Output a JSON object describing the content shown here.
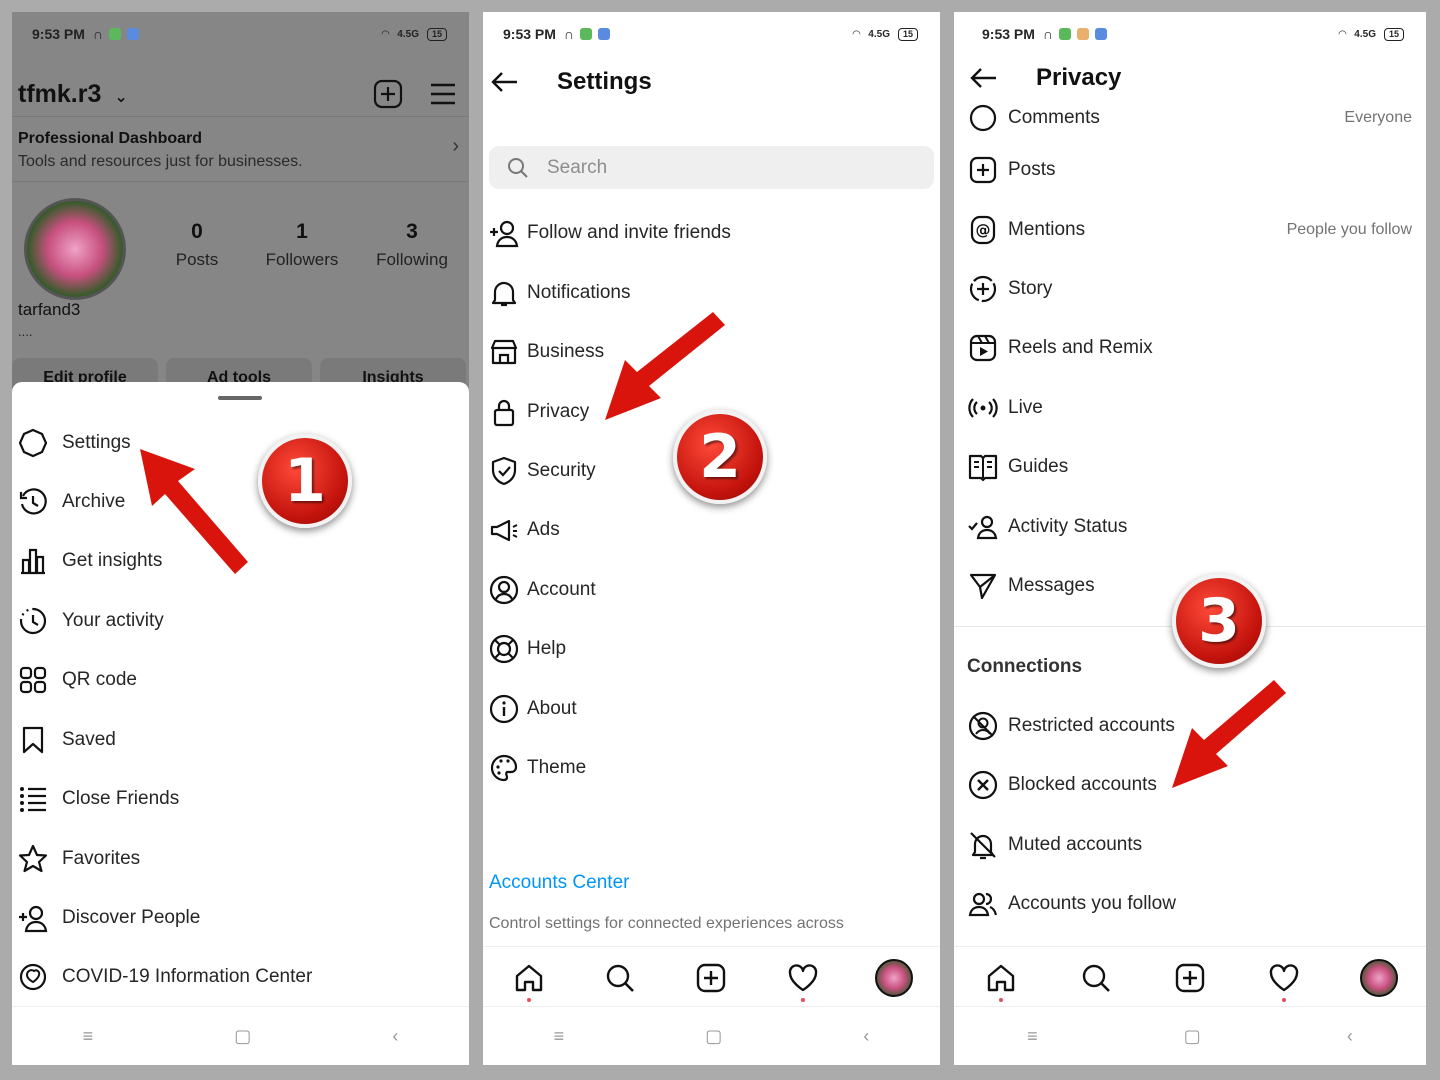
{
  "status": {
    "time": "9:53 PM",
    "network": "4.5G",
    "battery": "15"
  },
  "panel1": {
    "username": "tfmk.r3",
    "dashboard_title": "Professional Dashboard",
    "dashboard_sub": "Tools and resources just for businesses.",
    "stats": [
      {
        "value": "0",
        "label": "Posts"
      },
      {
        "value": "1",
        "label": "Followers"
      },
      {
        "value": "3",
        "label": "Following"
      }
    ],
    "display_name": "tarfand3",
    "bio": "....",
    "buttons": [
      "Edit profile",
      "Ad tools",
      "Insights"
    ],
    "menu": [
      "Settings",
      "Archive",
      "Get insights",
      "Your activity",
      "QR code",
      "Saved",
      "Close Friends",
      "Favorites",
      "Discover People",
      "COVID-19 Information Center"
    ],
    "badge": "1"
  },
  "panel2": {
    "title": "Settings",
    "search_placeholder": "Search",
    "menu": [
      "Follow and invite friends",
      "Notifications",
      "Business",
      "Privacy",
      "Security",
      "Ads",
      "Account",
      "Help",
      "About",
      "Theme"
    ],
    "accounts_center": "Accounts Center",
    "accounts_center_desc": "Control settings for connected experiences across",
    "badge": "2"
  },
  "panel3": {
    "title": "Privacy",
    "partial_row": {
      "label": "Comments",
      "value": "Everyone"
    },
    "items": [
      {
        "label": "Posts",
        "value": ""
      },
      {
        "label": "Mentions",
        "value": "People you follow"
      },
      {
        "label": "Story",
        "value": ""
      },
      {
        "label": "Reels and Remix",
        "value": ""
      },
      {
        "label": "Live",
        "value": ""
      },
      {
        "label": "Guides",
        "value": ""
      },
      {
        "label": "Activity Status",
        "value": ""
      },
      {
        "label": "Messages",
        "value": ""
      }
    ],
    "section": "Connections",
    "connections": [
      "Restricted accounts",
      "Blocked accounts",
      "Muted accounts",
      "Accounts you follow"
    ],
    "badge": "3"
  },
  "colors": {
    "accent_red": "#d8140d",
    "link_blue": "#0095f6",
    "notif_dot": "#ed4956"
  }
}
